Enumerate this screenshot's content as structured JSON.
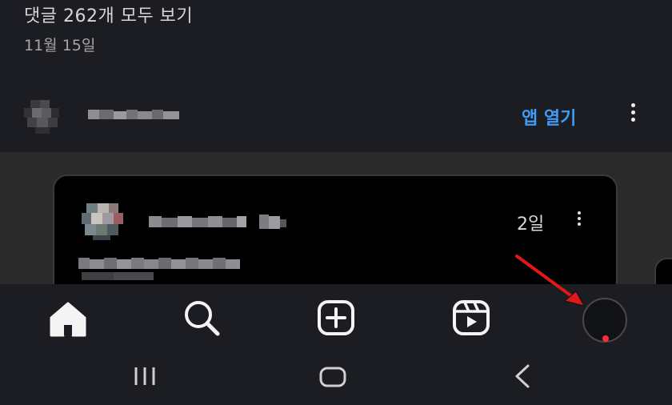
{
  "post": {
    "view_all_comments": "댓글 262개 모두 보기",
    "date": "11월 15일"
  },
  "next_post": {
    "open_app_label": "앱 열기",
    "more_icon": "more-vertical-icon",
    "embed": {
      "time_ago": "2일",
      "more_icon": "more-vertical-icon"
    }
  },
  "bottom_nav": {
    "items": [
      {
        "icon": "home-icon"
      },
      {
        "icon": "search-icon"
      },
      {
        "icon": "create-plus-icon"
      },
      {
        "icon": "reels-icon"
      },
      {
        "icon": "profile-avatar"
      }
    ],
    "notification_dot_color": "#ff2a3a"
  },
  "annotation": {
    "arrow_color": "#e01818"
  },
  "system_nav": {
    "items": [
      {
        "icon": "recents-icon"
      },
      {
        "icon": "home-outline-icon"
      },
      {
        "icon": "back-chevron-icon"
      }
    ]
  },
  "colors": {
    "background": "#1c1d22",
    "embed_background": "#2a2a2b",
    "card_background": "#000000",
    "accent_link": "#3f9cf5"
  }
}
